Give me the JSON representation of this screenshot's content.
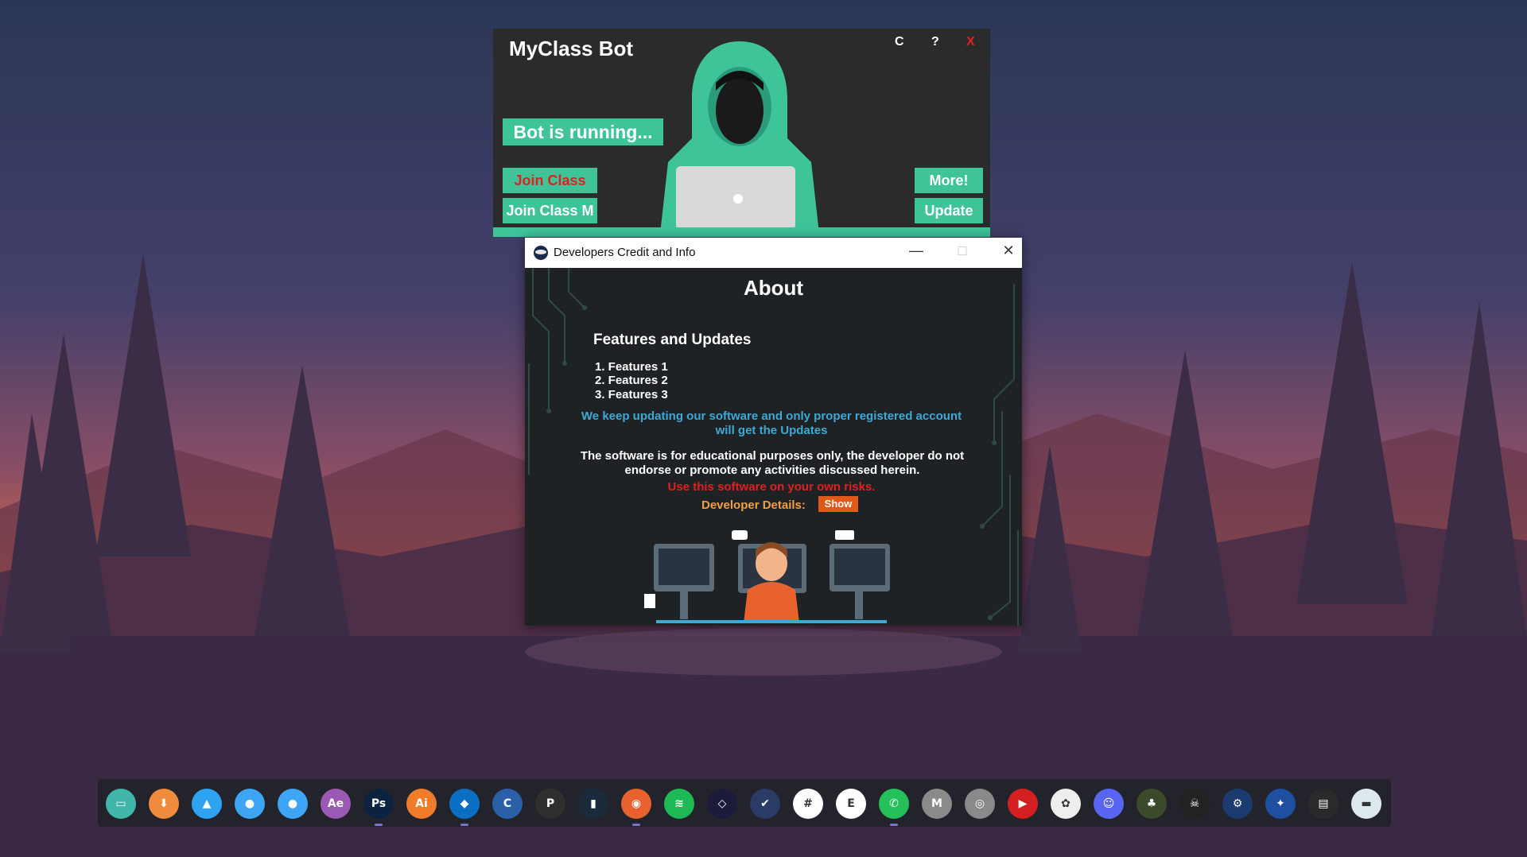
{
  "bot_window": {
    "title": "MyClass Bot",
    "controls": [
      "C",
      "?",
      "X"
    ],
    "status": "Bot is running...",
    "buttons": {
      "join_class": "Join Class",
      "join_class_m": "Join Class M",
      "more": "More!",
      "update": "Update"
    }
  },
  "about_window": {
    "window_title": "Developers Credit and Info",
    "heading": "About",
    "section_title": "Features and Updates",
    "features": [
      "1. Features 1",
      "2. Features 2",
      "3. Features 3"
    ],
    "update_notice": "We keep updating our software and only proper registered account will get the Updates",
    "disclaimer": "The software is for educational purposes only, the developer do not endorse or promote any activities discussed herein.",
    "risk_warning": "Use this software on your own risks.",
    "developer_details_label": "Developer Details:",
    "show_button": "Show"
  },
  "colors": {
    "accent": "#3fc49a",
    "danger": "#e02020",
    "notice": "#3fa9d4",
    "orange": "#e05a17"
  },
  "dock_icons": [
    {
      "name": "this-pc-icon",
      "color": "#3fb6a8",
      "glyph": "▭"
    },
    {
      "name": "downloads-icon",
      "color": "#f08a3c",
      "glyph": "⬇"
    },
    {
      "name": "photos-icon",
      "color": "#2ea3f2",
      "glyph": "▲"
    },
    {
      "name": "user-folder-icon",
      "color": "#3da5f4",
      "glyph": "●"
    },
    {
      "name": "user-folder-2-icon",
      "color": "#3da5f4",
      "glyph": "●"
    },
    {
      "name": "after-effects-icon",
      "color": "#9a5ab4",
      "glyph": "Ae"
    },
    {
      "name": "photoshop-icon",
      "color": "#0c2340",
      "glyph": "Ps"
    },
    {
      "name": "illustrator-icon",
      "color": "#f07b2a",
      "glyph": "Ai"
    },
    {
      "name": "vscode-icon",
      "color": "#0a6fc2",
      "glyph": "◆"
    },
    {
      "name": "c-language-icon",
      "color": "#2b5fa8",
      "glyph": "C"
    },
    {
      "name": "pycharm-icon",
      "color": "#2f2f2f",
      "glyph": "P"
    },
    {
      "name": "terminal-icon",
      "color": "#1b2a3a",
      "glyph": "▮"
    },
    {
      "name": "firefox-icon",
      "color": "#e8622e",
      "glyph": "◉"
    },
    {
      "name": "spotify-icon",
      "color": "#1db954",
      "glyph": "≋"
    },
    {
      "name": "gitkraken-icon",
      "color": "#1c1c3a",
      "glyph": "◇"
    },
    {
      "name": "todo-icon",
      "color": "#2a3b66",
      "glyph": "✔"
    },
    {
      "name": "slack-icon",
      "color": "#ffffff",
      "glyph": "#"
    },
    {
      "name": "evernote-icon",
      "color": "#ffffff",
      "glyph": "E"
    },
    {
      "name": "whatsapp-icon",
      "color": "#25c05a",
      "glyph": "✆"
    },
    {
      "name": "gmail-icon",
      "color": "#8a8a8a",
      "glyph": "M"
    },
    {
      "name": "camera-icon",
      "color": "#8a8a8a",
      "glyph": "◎"
    },
    {
      "name": "youtube-icon",
      "color": "#d31f1f",
      "glyph": "▶"
    },
    {
      "name": "stickers-icon",
      "color": "#eeeeee",
      "glyph": "✿"
    },
    {
      "name": "discord-icon",
      "color": "#5865f2",
      "glyph": "☺"
    },
    {
      "name": "game-icon",
      "color": "#3a4a2a",
      "glyph": "♣"
    },
    {
      "name": "game-2-icon",
      "color": "#222222",
      "glyph": "☠"
    },
    {
      "name": "steam-icon",
      "color": "#1b3b6f",
      "glyph": "⚙"
    },
    {
      "name": "app-icon",
      "color": "#1e4fa0",
      "glyph": "✦"
    },
    {
      "name": "app-2-icon",
      "color": "#2a2a2a",
      "glyph": "▤"
    },
    {
      "name": "screen-icon",
      "color": "#dde8ee",
      "glyph": "▬"
    }
  ]
}
